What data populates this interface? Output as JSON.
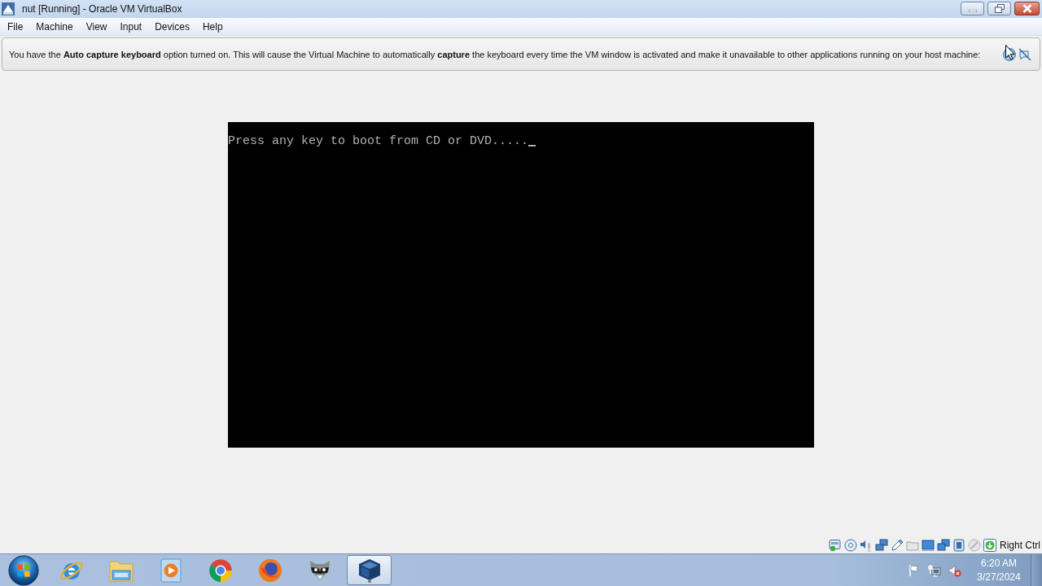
{
  "window": {
    "title": "nut [Running] - Oracle VM VirtualBox"
  },
  "menu": [
    {
      "label": "File"
    },
    {
      "label": "Machine"
    },
    {
      "label": "View"
    },
    {
      "label": "Input"
    },
    {
      "label": "Devices"
    },
    {
      "label": "Help"
    }
  ],
  "notification": {
    "text": "You have the **Auto capture keyboard** option turned on. This will cause the Virtual Machine to automatically **capture** the keyboard every time the VM window is activated and make it unavailable to other applications running on your host machine:"
  },
  "vm_screen": {
    "lines": [
      "Press any key to boot from CD or DVD....."
    ]
  },
  "status_bar": {
    "host_key": "Right Ctrl"
  },
  "taskbar": {
    "apps": [
      {
        "selected": false
      },
      {
        "selected": false
      },
      {
        "selected": false
      },
      {
        "selected": false
      },
      {
        "selected": false
      },
      {
        "selected": false
      },
      {
        "selected": true
      }
    ],
    "clock": {
      "time": "6:20 AM",
      "date": "3/27/2024"
    }
  }
}
